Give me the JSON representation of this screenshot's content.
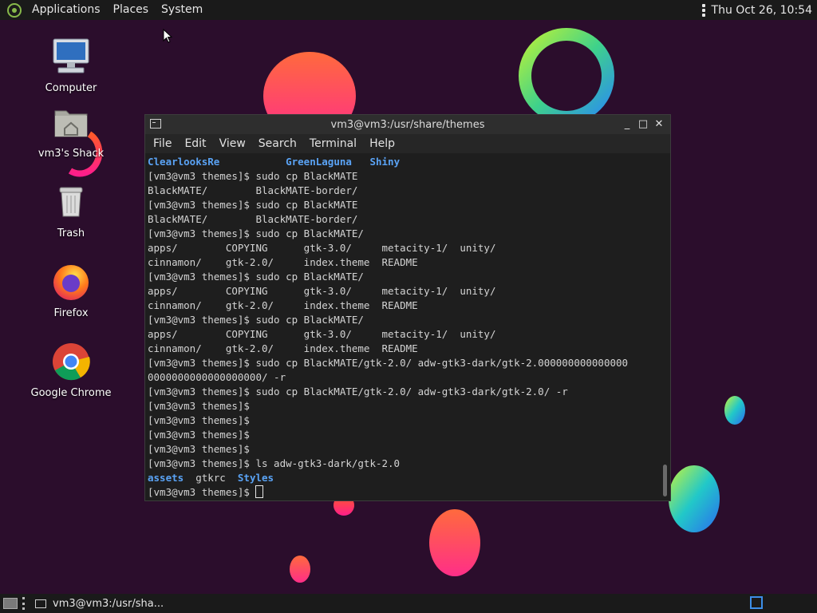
{
  "top_panel": {
    "menus": [
      "Applications",
      "Places",
      "System"
    ],
    "clock": "Thu Oct 26, 10:54"
  },
  "desktop": {
    "icons": [
      {
        "label": "Computer",
        "icon": "computer-icon"
      },
      {
        "label": "vm3's Shack",
        "icon": "home-folder-icon"
      },
      {
        "label": "Trash",
        "icon": "trash-icon"
      },
      {
        "label": "Firefox",
        "icon": "firefox-icon"
      },
      {
        "label": "Google Chrome",
        "icon": "chrome-icon"
      }
    ]
  },
  "terminal": {
    "title": "vm3@vm3:/usr/share/themes",
    "controls": {
      "minimize": "_",
      "maximize": "□",
      "close": "✕"
    },
    "menu": [
      "File",
      "Edit",
      "View",
      "Search",
      "Terminal",
      "Help"
    ],
    "lines": [
      [
        {
          "t": "ClearlooksRe",
          "c": "blue"
        },
        {
          "t": "           "
        },
        {
          "t": "GreenLaguna",
          "c": "blue"
        },
        {
          "t": "   "
        },
        {
          "t": "Shiny",
          "c": "blue"
        }
      ],
      [
        {
          "t": "[vm3@vm3 themes]$ sudo cp BlackMATE"
        }
      ],
      [
        {
          "t": "BlackMATE/        BlackMATE-border/"
        }
      ],
      [
        {
          "t": "[vm3@vm3 themes]$ sudo cp BlackMATE"
        }
      ],
      [
        {
          "t": "BlackMATE/        BlackMATE-border/"
        }
      ],
      [
        {
          "t": "[vm3@vm3 themes]$ sudo cp BlackMATE/"
        }
      ],
      [
        {
          "t": "apps/        COPYING      gtk-3.0/     metacity-1/  unity/"
        }
      ],
      [
        {
          "t": "cinnamon/    gtk-2.0/     index.theme  README"
        }
      ],
      [
        {
          "t": "[vm3@vm3 themes]$ sudo cp BlackMATE/"
        }
      ],
      [
        {
          "t": "apps/        COPYING      gtk-3.0/     metacity-1/  unity/"
        }
      ],
      [
        {
          "t": "cinnamon/    gtk-2.0/     index.theme  README"
        }
      ],
      [
        {
          "t": "[vm3@vm3 themes]$ sudo cp BlackMATE/"
        }
      ],
      [
        {
          "t": "apps/        COPYING      gtk-3.0/     metacity-1/  unity/"
        }
      ],
      [
        {
          "t": "cinnamon/    gtk-2.0/     index.theme  README"
        }
      ],
      [
        {
          "t": "[vm3@vm3 themes]$ sudo cp BlackMATE/gtk-2.0/ adw-gtk3-dark/gtk-2.000000000000000"
        }
      ],
      [
        {
          "t": "0000000000000000000/ -r"
        }
      ],
      [
        {
          "t": "[vm3@vm3 themes]$ sudo cp BlackMATE/gtk-2.0/ adw-gtk3-dark/gtk-2.0/ -r"
        }
      ],
      [
        {
          "t": "[vm3@vm3 themes]$"
        }
      ],
      [
        {
          "t": "[vm3@vm3 themes]$"
        }
      ],
      [
        {
          "t": "[vm3@vm3 themes]$"
        }
      ],
      [
        {
          "t": "[vm3@vm3 themes]$"
        }
      ],
      [
        {
          "t": "[vm3@vm3 themes]$ ls adw-gtk3-dark/gtk-2.0"
        }
      ],
      [
        {
          "t": "assets",
          "c": "blue"
        },
        {
          "t": "  gtkrc  "
        },
        {
          "t": "Styles",
          "c": "blue"
        }
      ],
      [
        {
          "t": "[vm3@vm3 themes]$ "
        }
      ]
    ]
  },
  "bottom_panel": {
    "task_label": "vm3@vm3:/usr/sha..."
  },
  "colors": {
    "desktop_bg": "#2b0d2c",
    "panel_bg": "#1a1a1a",
    "terminal_bg": "#1e1e1e",
    "directory_blue": "#5aa3f5",
    "workspace_accent": "#3d8ee8"
  }
}
